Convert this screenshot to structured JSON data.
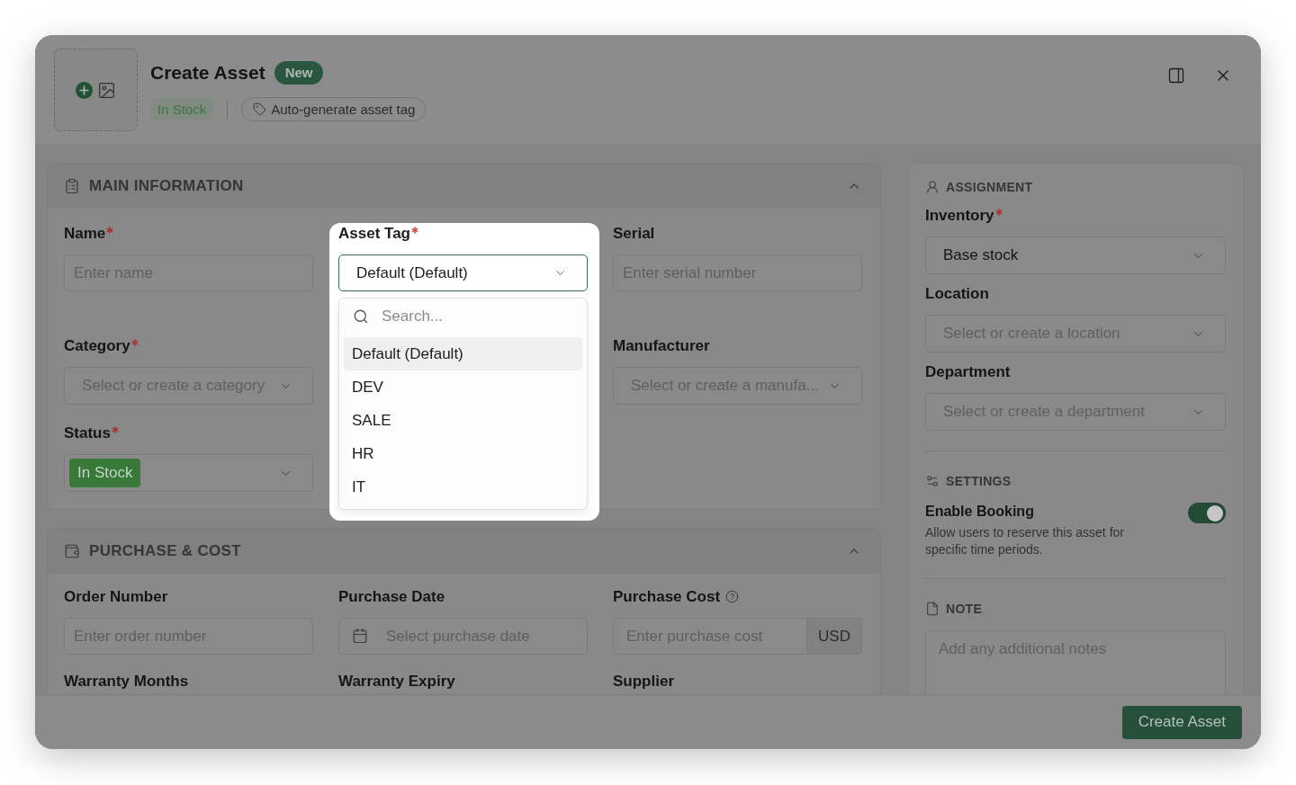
{
  "header": {
    "title": "Create Asset",
    "badge": "New",
    "status": "In Stock",
    "tag_chip": "Auto-generate asset tag"
  },
  "sections": [
    {
      "kind": "main",
      "title": "MAIN INFORMATION",
      "expanded": true,
      "fields": [
        {
          "kind": "text",
          "label": "Name",
          "required": true,
          "help": false,
          "placeholder": "Enter name"
        },
        {
          "kind": "combobox",
          "label": "Asset Tag",
          "required": true,
          "help": false,
          "value": "Default (Default)",
          "spotlight": true,
          "open": true,
          "search_placeholder": "Search...",
          "options": [
            {
              "label": "Default (Default)",
              "selected": true
            },
            {
              "label": "DEV",
              "selected": false
            },
            {
              "label": "SALE",
              "selected": false
            },
            {
              "label": "HR",
              "selected": false
            },
            {
              "label": "IT",
              "selected": false
            }
          ]
        },
        {
          "kind": "text",
          "label": "Serial",
          "required": false,
          "help": false,
          "placeholder": "Enter serial number"
        },
        {
          "kind": "select",
          "label": "Category",
          "required": true,
          "help": false,
          "placeholder": "Select or create a category"
        },
        {
          "kind": "select",
          "label": "Manufacturer",
          "required": false,
          "help": false,
          "placeholder": "Select or create a manufa..."
        },
        {
          "kind": "status",
          "label": "Status",
          "required": true,
          "help": false,
          "value": "In Stock"
        }
      ]
    },
    {
      "kind": "purchase",
      "title": "PURCHASE & COST",
      "expanded": true,
      "fields": [
        {
          "kind": "text",
          "label": "Order Number",
          "required": false,
          "help": false,
          "placeholder": "Enter order number"
        },
        {
          "kind": "date",
          "label": "Purchase Date",
          "required": false,
          "help": false,
          "placeholder": "Select purchase date"
        },
        {
          "kind": "currency",
          "label": "Purchase Cost",
          "required": false,
          "help": true,
          "placeholder": "Enter purchase cost",
          "unit": "USD"
        },
        {
          "kind": "label",
          "label": "Warranty Months",
          "required": false,
          "help": false
        },
        {
          "kind": "label",
          "label": "Warranty Expiry",
          "required": false,
          "help": false
        },
        {
          "kind": "label",
          "label": "Supplier",
          "required": false,
          "help": false
        }
      ]
    }
  ],
  "sidebar": {
    "sections": [
      {
        "kind": "assignment",
        "title": "ASSIGNMENT",
        "fields": [
          {
            "kind": "select",
            "label": "Inventory",
            "required": true,
            "help": false,
            "value": "Base stock"
          },
          {
            "kind": "select",
            "label": "Location",
            "required": false,
            "help": false,
            "placeholder": "Select or create a location"
          },
          {
            "kind": "select",
            "label": "Department",
            "required": false,
            "help": false,
            "placeholder": "Select or create a department"
          }
        ]
      },
      {
        "kind": "settings",
        "title": "SETTINGS",
        "toggles": [
          {
            "label": "Enable Booking",
            "description": "Allow users to reserve this asset for specific time periods.",
            "on": true
          }
        ]
      },
      {
        "kind": "note",
        "title": "NOTE",
        "placeholder": "Add any additional notes"
      }
    ]
  },
  "footer": {
    "primary_button": "Create Asset"
  }
}
